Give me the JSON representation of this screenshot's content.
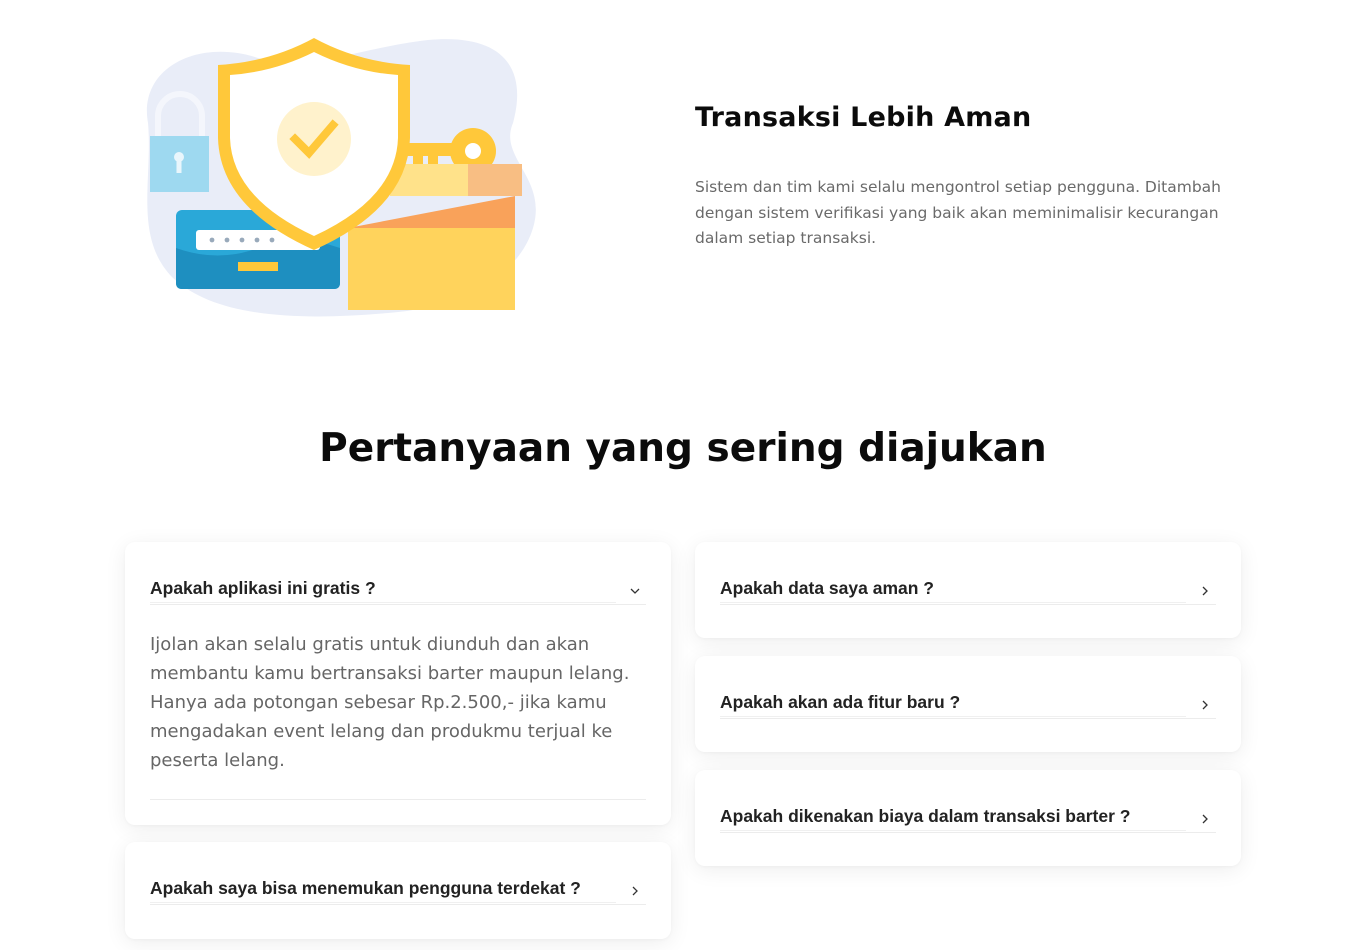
{
  "feature": {
    "title": "Transaksi Lebih Aman",
    "description": "Sistem dan tim kami selalu mengontrol setiap pengguna. Ditambah dengan sistem verifikasi yang baik akan meminimalisir kecurangan dalam setiap transaksi."
  },
  "faq": {
    "heading": "Pertanyaan yang sering diajukan",
    "left": [
      {
        "question": "Apakah aplikasi ini gratis ?",
        "expanded": true,
        "answer": "Ijolan akan selalu gratis untuk diunduh dan akan membantu kamu bertransaksi barter maupun lelang. Hanya ada potongan sebesar Rp.2.500,- jika kamu mengadakan event lelang dan produkmu terjual ke peserta lelang."
      },
      {
        "question": "Apakah saya bisa menemukan pengguna terdekat ?",
        "expanded": false
      }
    ],
    "right": [
      {
        "question": "Apakah data saya aman ?",
        "expanded": false
      },
      {
        "question": "Apakah akan ada fitur baru ?",
        "expanded": false
      },
      {
        "question": "Apakah dikenakan biaya dalam transaksi barter ?",
        "expanded": false
      }
    ]
  },
  "icons": {
    "expanded": "chevron-down-icon",
    "collapsed": "chevron-right-icon"
  },
  "colors": {
    "shield": "#FFC83A",
    "blob": "#E9EDF8",
    "card_blue": "#2AA8D8",
    "lock": "#9ED9F0",
    "box": "#FFD35C",
    "box_orange": "#F9A25A"
  }
}
